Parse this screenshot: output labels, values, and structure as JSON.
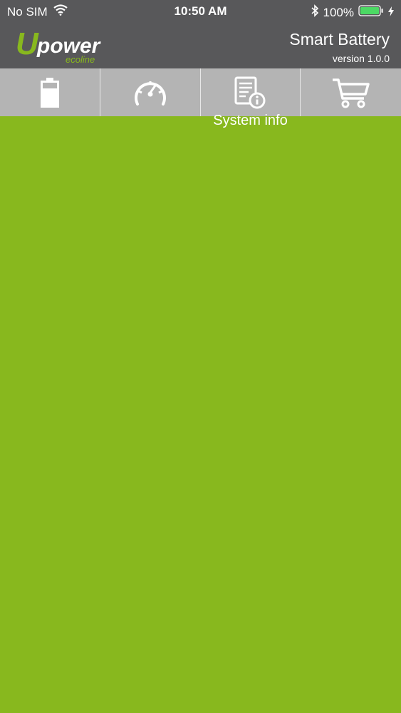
{
  "status": {
    "carrier": "No SIM",
    "time": "10:50 AM",
    "battery_text": "100%"
  },
  "header": {
    "logo_main": "Upower",
    "logo_sub": "ecoline",
    "title": "Smart Battery",
    "version": "version 1.0.0"
  },
  "tabs": [
    {
      "icon": "battery-icon"
    },
    {
      "icon": "speedometer-icon"
    },
    {
      "icon": "system-info-icon"
    },
    {
      "icon": "cart-icon"
    }
  ],
  "tooltip": "System info",
  "colors": {
    "status_bg": "#58585a",
    "header_bg": "#58585a",
    "tabbar_bg": "#b4b4b4",
    "content_bg": "#88b81e",
    "battery_green": "#4cd964"
  }
}
